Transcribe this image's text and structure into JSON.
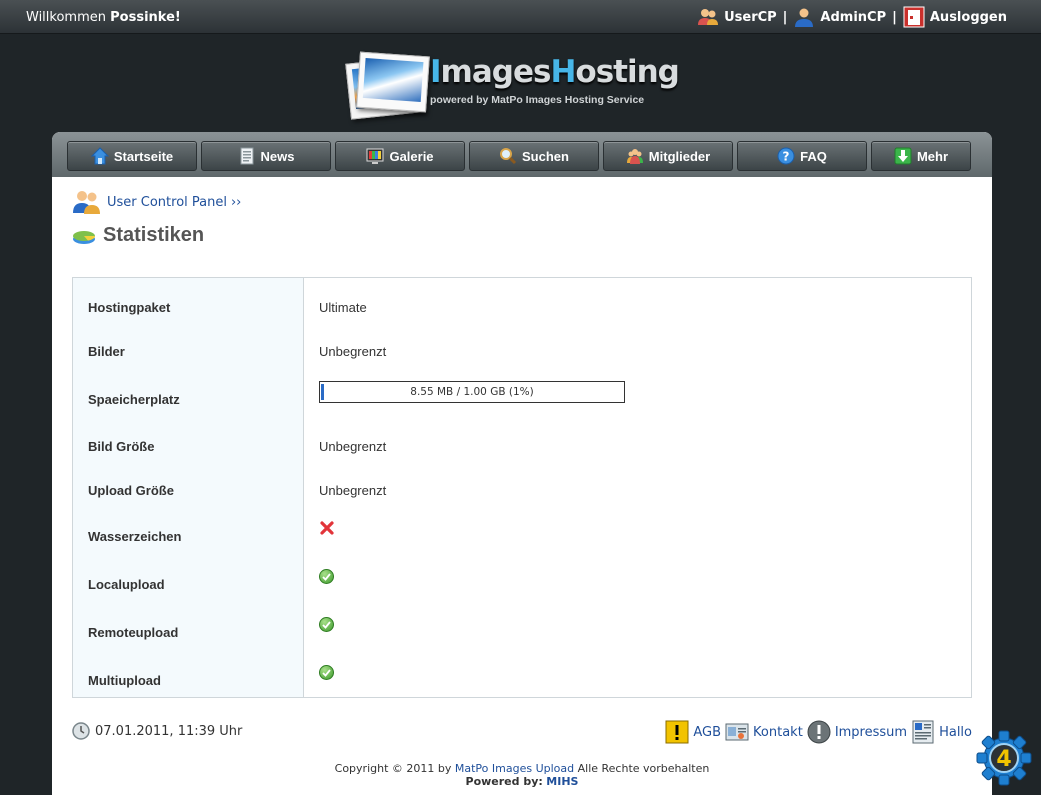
{
  "topbar": {
    "welcome_prefix": "Willkommen",
    "username": "Possinke!",
    "usercp_label": "UserCP",
    "admincp_label": "AdminCP",
    "logout_label": "Ausloggen",
    "separator": "|"
  },
  "logo": {
    "title_part1": "I",
    "title_part2": "mages",
    "title_part3": "H",
    "title_part4": "osting",
    "subtitle": "powered by MatPo Images Hosting Service"
  },
  "nav": {
    "items": [
      {
        "label": "Startseite",
        "icon": "home-icon"
      },
      {
        "label": "News",
        "icon": "document-icon"
      },
      {
        "label": "Galerie",
        "icon": "gallery-icon"
      },
      {
        "label": "Suchen",
        "icon": "search-icon"
      },
      {
        "label": "Mitglieder",
        "icon": "members-icon"
      },
      {
        "label": "FAQ",
        "icon": "help-icon"
      },
      {
        "label": "Mehr",
        "icon": "download-icon"
      }
    ]
  },
  "breadcrumb": {
    "link": "User Control Panel",
    "sep": "››"
  },
  "page": {
    "title": "Statistiken"
  },
  "stats": {
    "rows": [
      {
        "label": "Hostingpaket",
        "value": "Ultimate"
      },
      {
        "label": "Bilder",
        "value": "Unbegrenzt"
      },
      {
        "label": "Spaeicherplatz",
        "value": "8.55 MB / 1.00 GB (1%)",
        "progress_percent": 1
      },
      {
        "label": "Bild Größe",
        "value": "Unbegrenzt"
      },
      {
        "label": "Upload Größe",
        "value": "Unbegrenzt"
      },
      {
        "label": "Wasserzeichen",
        "value_icon": "x-icon"
      },
      {
        "label": "Localupload",
        "value_icon": "check-icon"
      },
      {
        "label": "Remoteupload",
        "value_icon": "check-icon"
      },
      {
        "label": "Multiupload",
        "value_icon": "check-icon"
      }
    ]
  },
  "footer": {
    "datetime": "07.01.2011, 11:39 Uhr",
    "links": {
      "agb": "AGB",
      "kontakt": "Kontakt",
      "impressum": "Impressum",
      "hallo": "Hallo"
    },
    "copyright_prefix": "Copyright © 2011 by",
    "copyright_link": "MatPo Images Upload",
    "copyright_suffix": "Alle Rechte vorbehalten",
    "powered_label": "Powered by:",
    "powered_link": "MIHS"
  },
  "badge": {
    "text": "4"
  },
  "colors": {
    "background": "#1f2528",
    "link": "#1f4f9a",
    "accent": "#47b6e8",
    "progress": "#2a6bc6"
  }
}
